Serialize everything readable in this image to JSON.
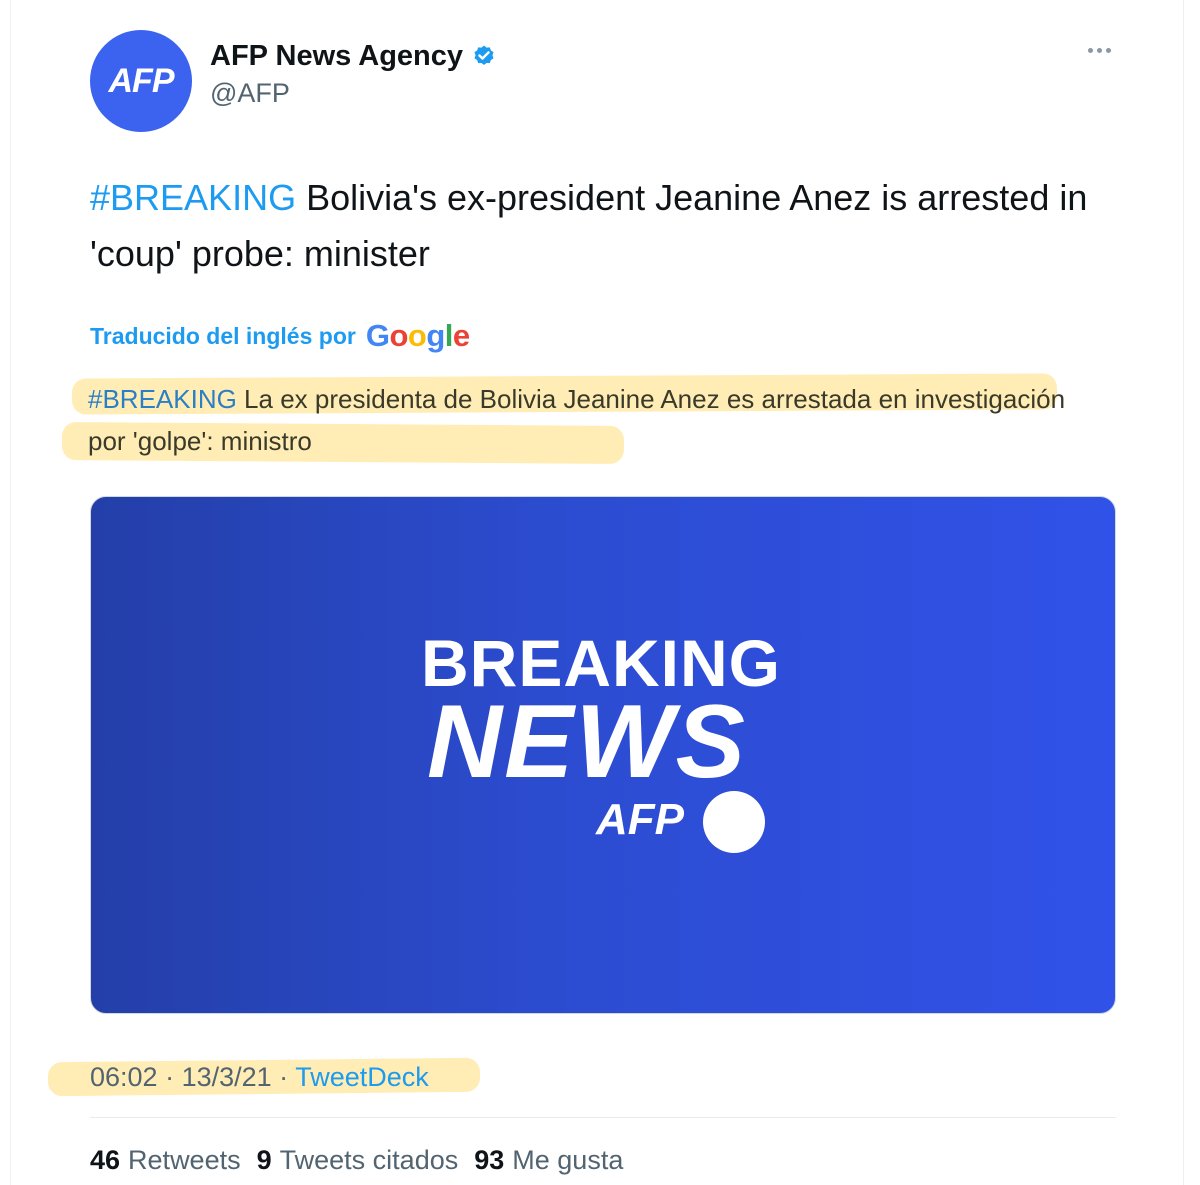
{
  "account": {
    "avatar_text": "AFP",
    "display_name": "AFP News Agency",
    "handle": "@AFP",
    "verified_icon": "verified-badge-icon"
  },
  "tweet": {
    "hashtag": "#BREAKING",
    "text": " Bolivia's ex-president Jeanine Anez is arrested in 'coup' probe: minister"
  },
  "translation": {
    "label": "Traducido del inglés por",
    "provider": "Google",
    "hashtag": "#BREAKING",
    "text": " La ex presidenta de Bolivia Jeanine Anez es arrestada en investigación por 'golpe': ministro"
  },
  "media": {
    "line1": "BREAKING",
    "line2": "NEWS",
    "brand": "AFP"
  },
  "meta": {
    "time": "06:02",
    "sep1": " · ",
    "date": "13/3/21",
    "sep2": " · ",
    "source": "TweetDeck"
  },
  "stats": [
    {
      "count": "46",
      "label": "Retweets"
    },
    {
      "count": "9",
      "label": "Tweets citados"
    },
    {
      "count": "93",
      "label": "Me gusta"
    }
  ],
  "colors": {
    "link": "#1d9bf0",
    "avatar": "#3b63f0",
    "highlight": "#ffd65a"
  }
}
